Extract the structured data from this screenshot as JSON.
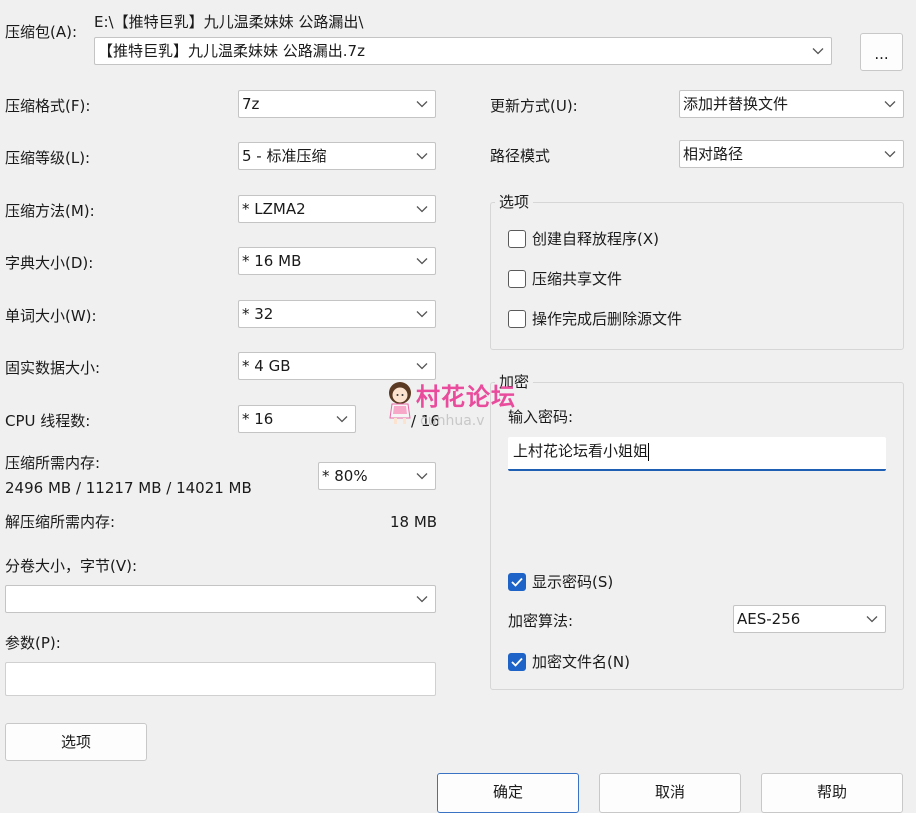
{
  "archive": {
    "label": "压缩包(A):",
    "folder_path": "E:\\【推特巨乳】九儿温柔妹妹 公路漏出\\",
    "filename": "【推特巨乳】九儿温柔妹妹 公路漏出.7z",
    "browse_label": "..."
  },
  "left": {
    "format": {
      "label": "压缩格式(F):",
      "value": "7z"
    },
    "level": {
      "label": "压缩等级(L):",
      "value": "5 - 标准压缩"
    },
    "method": {
      "label": "压缩方法(M):",
      "value": "*  LZMA2"
    },
    "dict": {
      "label": "字典大小(D):",
      "value": "*  16 MB"
    },
    "word": {
      "label": "单词大小(W):",
      "value": "*  32"
    },
    "solid": {
      "label": "固实数据大小:",
      "value": "*  4 GB"
    },
    "threads": {
      "label": "CPU 线程数:",
      "value": "*  16",
      "total": "/ 16"
    },
    "mem_compress": {
      "label": "压缩所需内存:",
      "detail": "2496 MB / 11217 MB / 14021 MB",
      "value": "* 80%"
    },
    "mem_decompress": {
      "label": "解压缩所需内存:",
      "value": "18 MB"
    },
    "volume": {
      "label": "分卷大小，字节(V):",
      "value": ""
    },
    "params": {
      "label": "参数(P):",
      "value": ""
    },
    "options_button": "选项"
  },
  "right": {
    "update": {
      "label": "更新方式(U):",
      "value": "添加并替换文件"
    },
    "path_mode": {
      "label": "路径模式",
      "value": "相对路径"
    },
    "options_group": {
      "title": "选项",
      "sfx": {
        "label": "创建自释放程序(X)",
        "checked": false
      },
      "shared": {
        "label": "压缩共享文件",
        "checked": false
      },
      "delete": {
        "label": "操作完成后删除源文件",
        "checked": false
      }
    },
    "encryption": {
      "title": "加密",
      "password_label": "输入密码:",
      "password_value": "上村花论坛看小姐姐",
      "show_password": {
        "label": "显示密码(S)",
        "checked": true
      },
      "method_label": "加密算法:",
      "method_value": "AES-256",
      "encrypt_names": {
        "label": "加密文件名(N)",
        "checked": true
      }
    }
  },
  "watermark": {
    "text": "村花论坛",
    "sub": "cunhua.v"
  },
  "buttons": {
    "ok": "确定",
    "cancel": "取消",
    "help": "帮助"
  }
}
